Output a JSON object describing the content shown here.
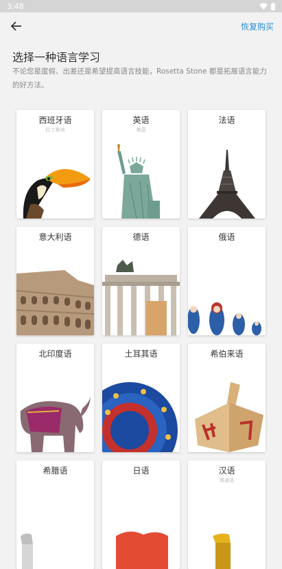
{
  "status": {
    "time": "3:48"
  },
  "header": {
    "restore_label": "恢复购买"
  },
  "page": {
    "title": "选择一种语言学习",
    "subtitle": "不论您是度假、出差还是希望提高语言技能，Rosetta Stone 都是拓展语言能力的好方法。"
  },
  "languages": [
    {
      "name": "西班牙语",
      "native": "拉丁美洲",
      "image": "toucan-image"
    },
    {
      "name": "英语",
      "native": "美国",
      "image": "statue-of-liberty-image"
    },
    {
      "name": "法语",
      "native": "",
      "image": "eiffel-tower-image"
    },
    {
      "name": "意大利语",
      "native": "",
      "image": "colosseum-image"
    },
    {
      "name": "德语",
      "native": "",
      "image": "brandenburg-gate-image"
    },
    {
      "name": "俄语",
      "native": "",
      "image": "matryoshka-dolls-image"
    },
    {
      "name": "北印度语",
      "native": "",
      "image": "elephant-image"
    },
    {
      "name": "土耳其语",
      "native": "",
      "image": "decorative-plate-image"
    },
    {
      "name": "希伯来语",
      "native": "",
      "image": "dreidel-image"
    },
    {
      "name": "希腊语",
      "native": "",
      "image": "greek-image"
    },
    {
      "name": "日语",
      "native": "",
      "image": "japanese-image"
    },
    {
      "name": "汉语",
      "native": "普通话",
      "image": "chinese-image"
    }
  ]
}
